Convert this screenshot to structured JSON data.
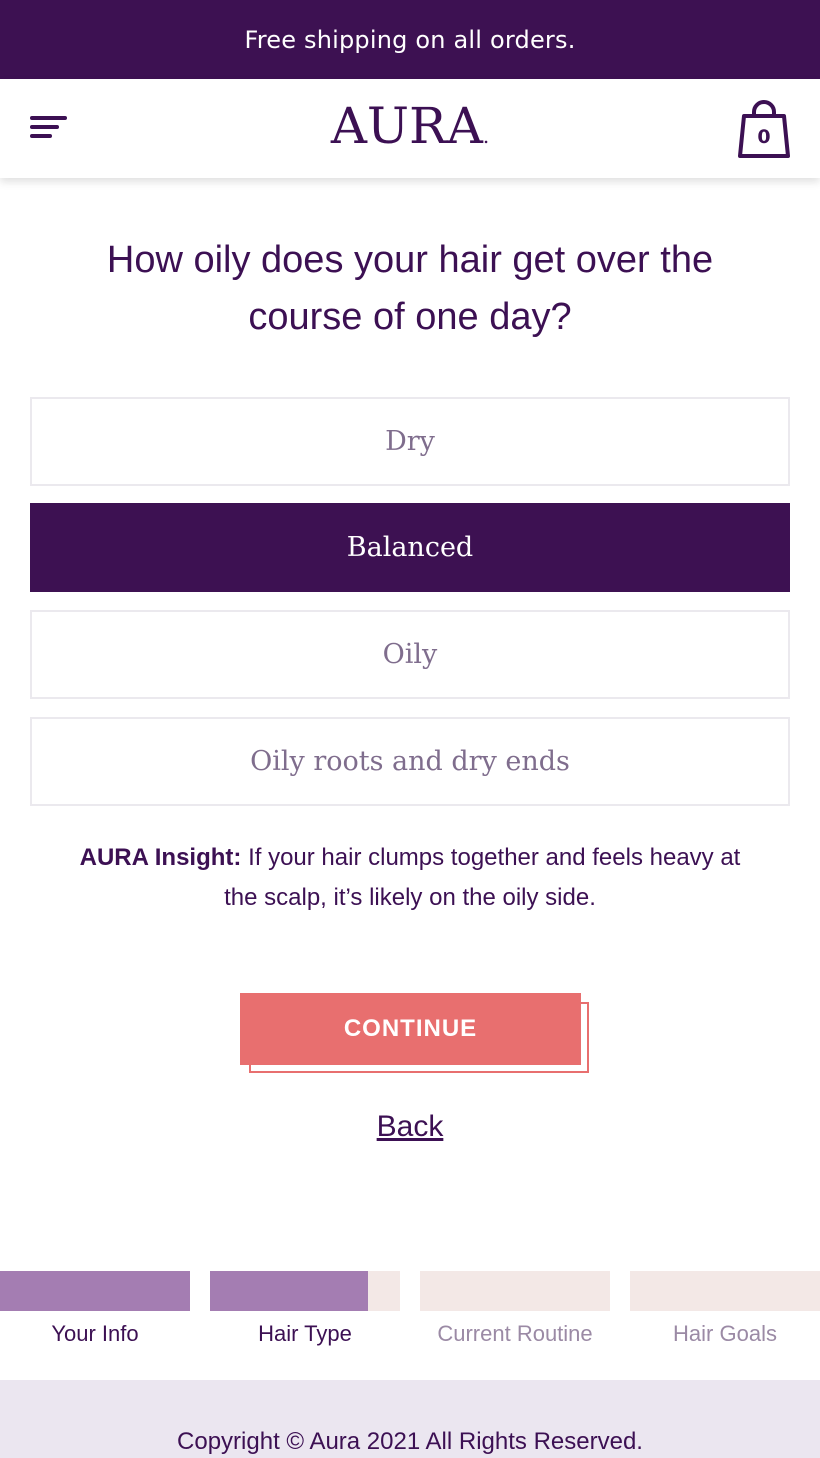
{
  "promo": {
    "text": "Free shipping on all orders."
  },
  "header": {
    "logo": "AURA",
    "logo_dot": ".",
    "cart_count": "0"
  },
  "quiz": {
    "question": "How oily does your hair get over the course of one day?",
    "options": [
      {
        "label": "Dry",
        "selected": false
      },
      {
        "label": "Balanced",
        "selected": true
      },
      {
        "label": "Oily",
        "selected": false
      },
      {
        "label": "Oily roots and dry ends",
        "selected": false
      }
    ],
    "insight_title": "AURA Insight:",
    "insight_text": " If your hair clumps together and feels heavy at the scalp, it’s likely on the oily side.",
    "continue_label": "CONTINUE",
    "back_label": "Back"
  },
  "progress": {
    "steps": [
      {
        "label": "Your Info",
        "fill": 1.0
      },
      {
        "label": "Hair Type",
        "fill": 0.83
      },
      {
        "label": "Current Routine",
        "fill": 0
      },
      {
        "label": "Hair Goals",
        "fill": 0
      }
    ]
  },
  "footer": {
    "copyright": "Copyright © Aura 2021 All Rights Reserved."
  },
  "colors": {
    "brand_purple": "#3d1152",
    "accent_coral": "#e86f6f",
    "progress_fill": "#a47db2",
    "progress_track": "#f3e8e6"
  }
}
